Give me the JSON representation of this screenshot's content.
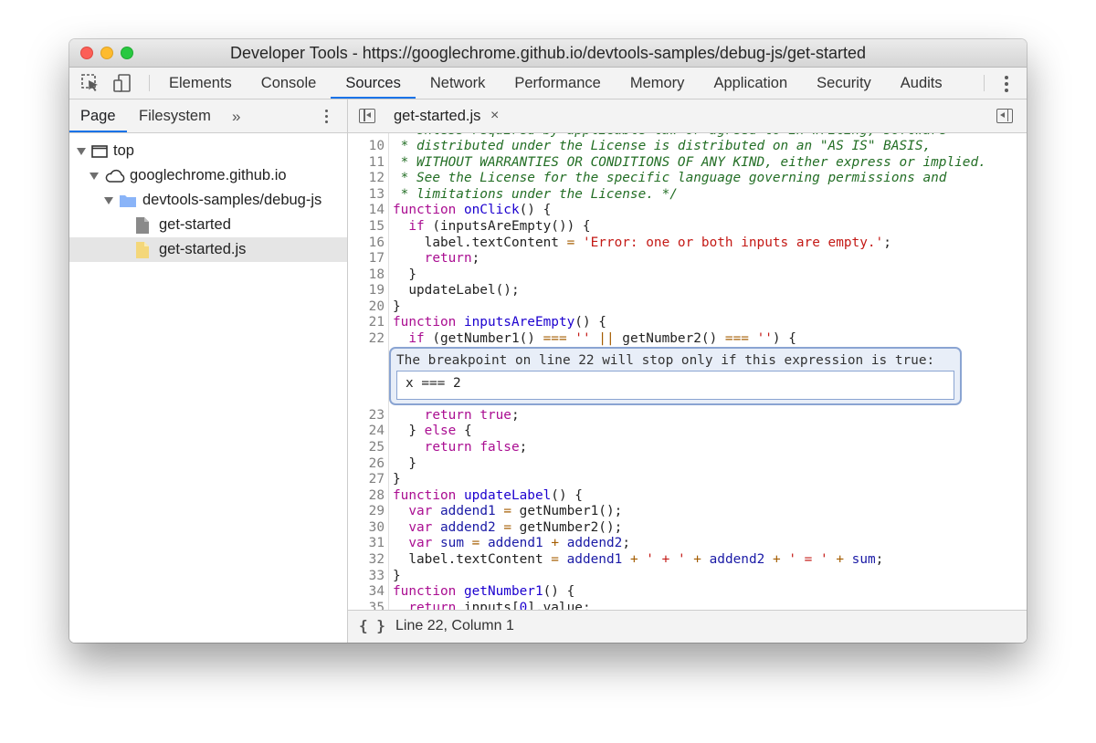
{
  "window": {
    "title": "Developer Tools - https://googlechrome.github.io/devtools-samples/debug-js/get-started"
  },
  "toolbar": {
    "inspect_icon": "select-element-icon",
    "device_icon": "device-toggle-icon",
    "tabs": [
      "Elements",
      "Console",
      "Sources",
      "Network",
      "Performance",
      "Memory",
      "Application",
      "Security",
      "Audits"
    ],
    "active_tab": "Sources",
    "accent_color": "#1a73e8"
  },
  "navigator": {
    "tabs": [
      "Page",
      "Filesystem"
    ],
    "more": "»",
    "tree": [
      {
        "label": "top",
        "icon": "frame-icon"
      },
      {
        "label": "googlechrome.github.io",
        "icon": "cloud-icon"
      },
      {
        "label": "devtools-samples/debug-js",
        "icon": "folder-icon"
      },
      {
        "label": "get-started",
        "icon": "document-icon"
      },
      {
        "label": "get-started.js",
        "icon": "script-file-icon"
      }
    ]
  },
  "editor": {
    "file_tab": "get-started.js",
    "close_glyph": "×",
    "line_numbers": [
      "10",
      "11",
      "12",
      "13",
      "14",
      "15",
      "16",
      "17",
      "18",
      "19",
      "20",
      "21",
      "22",
      "23",
      "24",
      "25",
      "26",
      "27",
      "28",
      "29",
      "30",
      "31",
      "32",
      "33",
      "34",
      "35"
    ],
    "breakpoint": {
      "message": "The breakpoint on line 22 will stop only if this expression is true:",
      "expression": "x === 2"
    }
  },
  "status": {
    "format_button": "{ }",
    "position": "Line 22, Column 1"
  }
}
